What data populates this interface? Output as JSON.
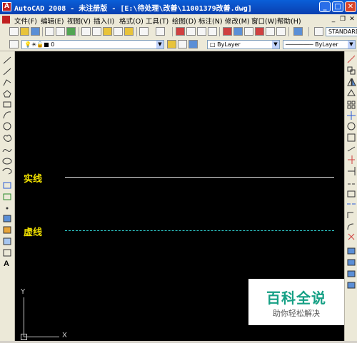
{
  "window": {
    "title": "AutoCAD 2008 - 未注册版 - [E:\\待处理\\改善\\11001379改善.dwg]",
    "app_icon": "autocad-logo-icon",
    "controls": {
      "minimize": "_",
      "maximize": "□",
      "close": "✕"
    }
  },
  "menubar": {
    "items": [
      "文件(F)",
      "编辑(E)",
      "视图(V)",
      "插入(I)",
      "格式(O)",
      "工具(T)",
      "绘图(D)",
      "标注(N)",
      "修改(M)",
      "窗口(W)",
      "帮助(H)"
    ],
    "mdi_controls": {
      "minimize": "_",
      "restore": "❐",
      "close": "✕"
    }
  },
  "toolbar": {
    "text_style_value": "STANDARD",
    "layer_value": "0",
    "color_value": "ByLayer",
    "linetype_value": "ByLayer"
  },
  "left_toolbar": {
    "icons": [
      "line-icon",
      "construction-line-icon",
      "polyline-icon",
      "polygon-icon",
      "rectangle-icon",
      "arc-icon",
      "circle-icon",
      "revision-cloud-icon",
      "spline-icon",
      "ellipse-icon",
      "ellipse-arc-icon",
      "insert-block-icon",
      "make-block-icon",
      "point-icon",
      "hatch-icon",
      "gradient-icon",
      "region-icon",
      "table-icon",
      "multiline-text-icon"
    ],
    "text_tool_label": "A"
  },
  "right_toolbar": {
    "icons": [
      "erase-icon",
      "copy-icon",
      "mirror-icon",
      "offset-icon",
      "array-icon",
      "move-icon",
      "rotate-icon",
      "scale-icon",
      "stretch-icon",
      "trim-icon",
      "extend-icon",
      "break-at-point-icon",
      "break-icon",
      "join-icon",
      "chamfer-icon",
      "fillet-icon",
      "explode-icon"
    ]
  },
  "drawing": {
    "solid_label": "实线",
    "dashed_label": "虚线",
    "ucs_x": "X",
    "ucs_y": "Y"
  },
  "watermark": {
    "main": "百科全说",
    "sub": "助你轻松解决"
  },
  "colors": {
    "canvas_bg": "#000000",
    "label_yellow": "#f0e000",
    "solid_line": "#e6e6e6",
    "dashed_line": "#2fd0d0",
    "watermark_green": "#16a085"
  }
}
